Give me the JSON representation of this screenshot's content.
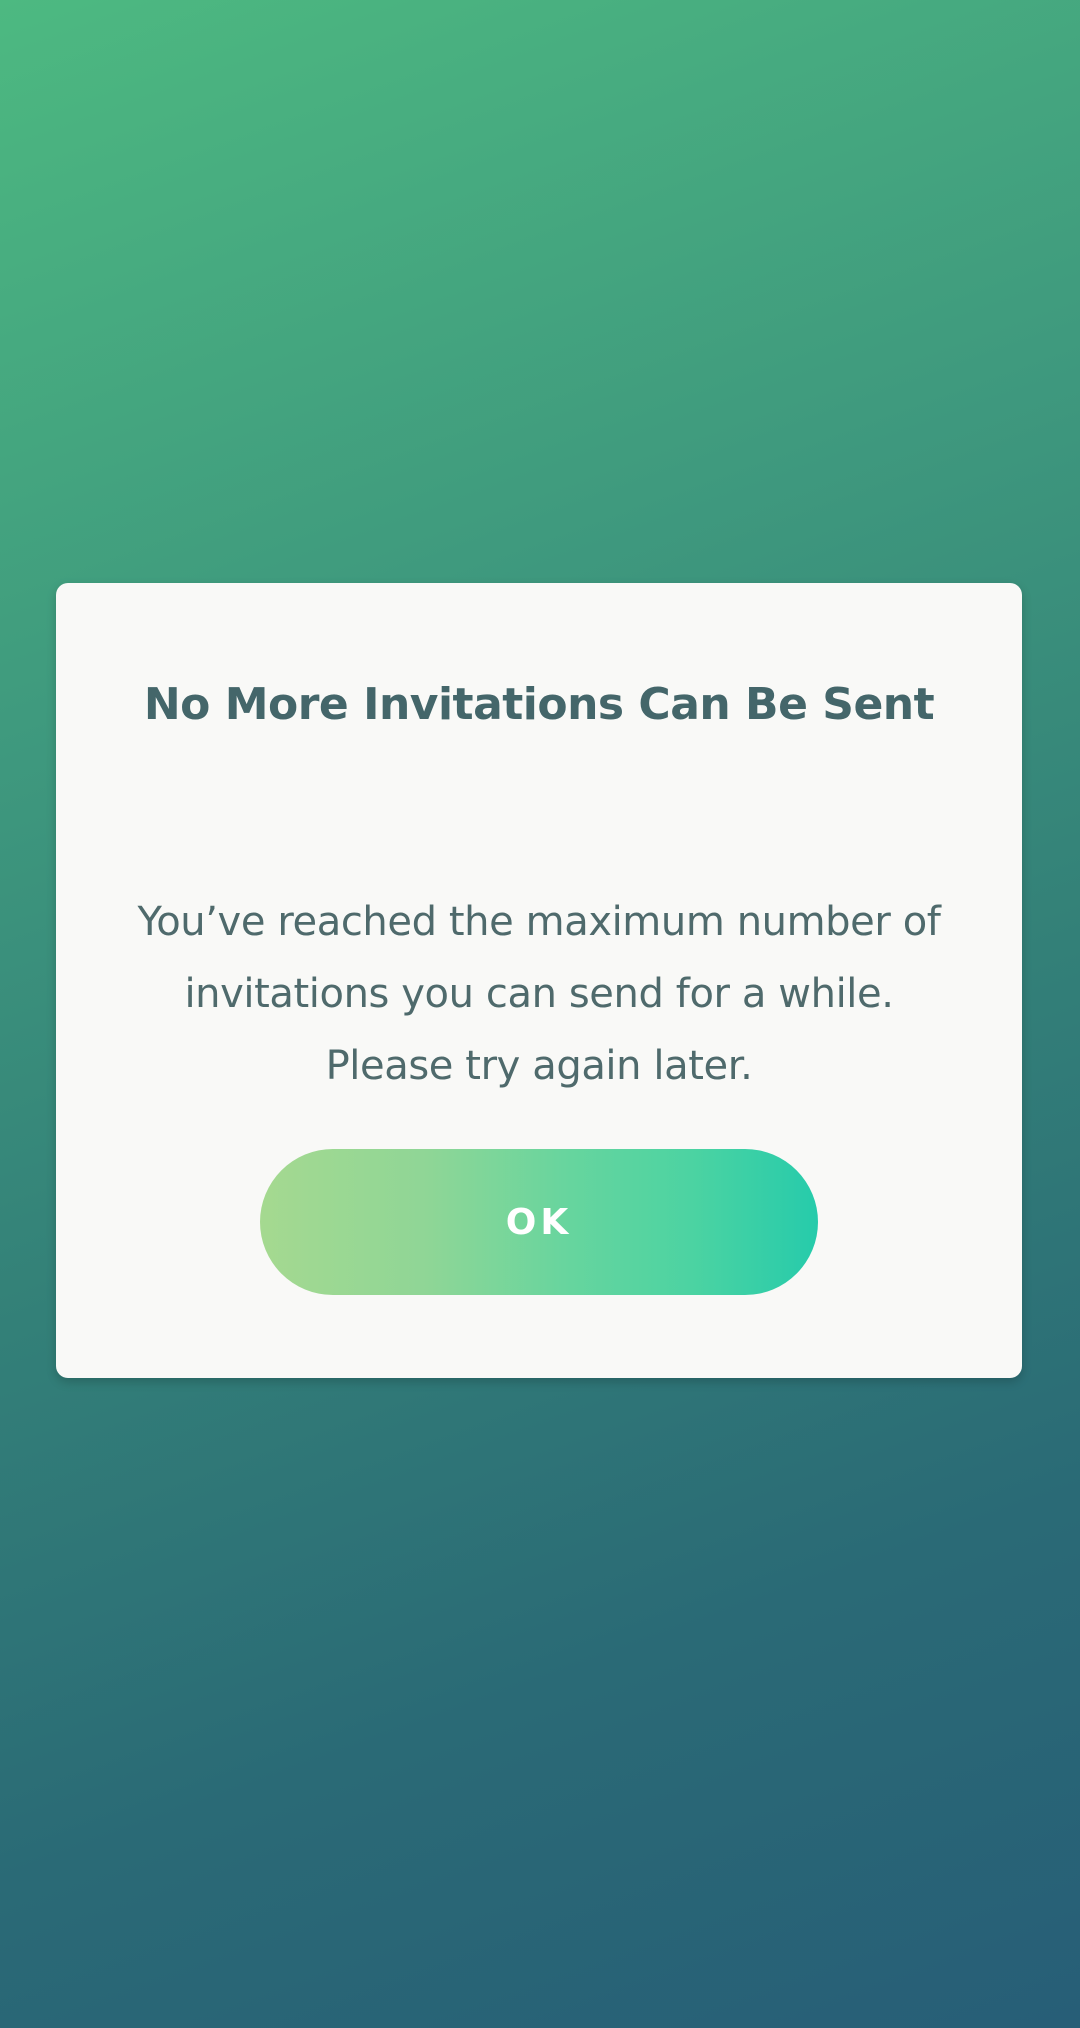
{
  "dialog": {
    "title": "No More Invitations Can Be Sent",
    "message": "You’ve reached the maximum number of invitations you can send for a while. Please try again later.",
    "ok_label": "OK"
  },
  "colors": {
    "background_top": "#4db981",
    "background_bottom": "#275e77",
    "dialog_background": "#f9f9f7",
    "text": "#44666a",
    "button_start": "#a5d990",
    "button_end": "#26cbab"
  }
}
